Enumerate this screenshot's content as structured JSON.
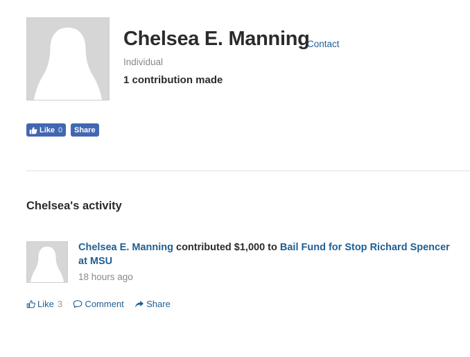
{
  "profile": {
    "name": "Chelsea E. Manning",
    "contact_label": "Contact",
    "contact_separator": "·",
    "type": "Individual",
    "contributions": "1 contribution made"
  },
  "social": {
    "like_label": "Like",
    "like_count": "0",
    "share_label": "Share"
  },
  "activity": {
    "heading": "Chelsea's activity",
    "items": [
      {
        "actor": "Chelsea E. Manning",
        "verb": "contributed $1,000 to",
        "target": "Bail Fund for Stop Richard Spencer at MSU",
        "time": "18 hours ago",
        "actions": {
          "like_label": "Like",
          "like_count": "3",
          "comment_label": "Comment",
          "share_label": "Share",
          "separator": "·"
        }
      }
    ]
  },
  "colors": {
    "link": "#1f5f94",
    "facebook": "#4267b2",
    "placeholder": "#d6d6d6"
  }
}
